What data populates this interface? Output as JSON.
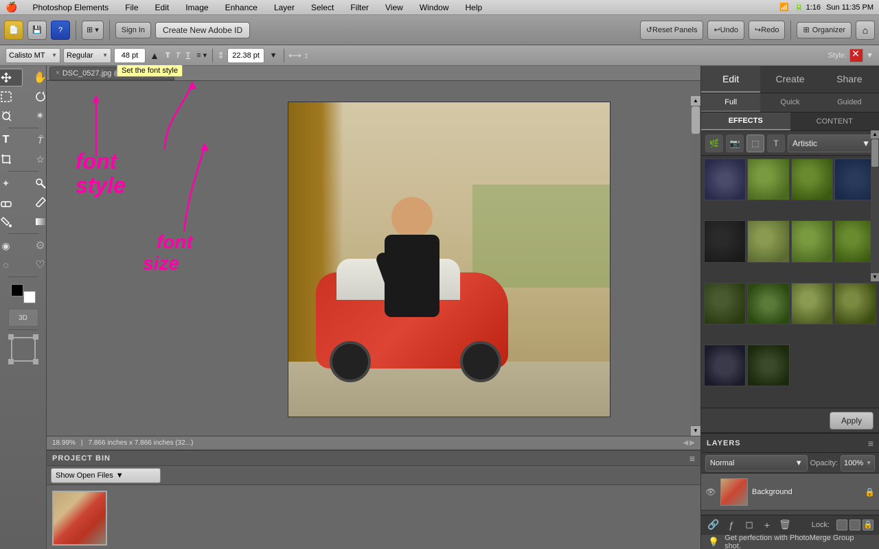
{
  "menubar": {
    "apple": "🍎",
    "app_name": "Photoshop Elements",
    "menus": [
      "File",
      "Edit",
      "Image",
      "Enhance",
      "Layer",
      "Select",
      "Filter",
      "View",
      "Window",
      "Help"
    ],
    "time": "Sun 11:35 PM",
    "battery": "1:16"
  },
  "toolbar": {
    "sign_in_label": "Sign In",
    "create_adobe_label": "Create New Adobe ID",
    "reset_panels_label": "Reset Panels",
    "undo_label": "Undo",
    "redo_label": "Redo",
    "organizer_label": "Organizer"
  },
  "font_toolbar": {
    "font_name": "Calisto MT",
    "font_style": "Regular",
    "font_size": "48 pt",
    "tooltip": "Set the font style",
    "style_label": "Style:"
  },
  "tab": {
    "name": "DSC_0527.jpg @ 19% (RGB/8)",
    "close": "×"
  },
  "annotations": {
    "font_style_label": "font\nstyle",
    "font_size_label": "font\nsize"
  },
  "status_bar": {
    "zoom": "18.99%",
    "dimensions": "7.866 inches x 7.866 inches (32...)"
  },
  "project_bin": {
    "title": "PROJECT BIN",
    "show_open_files": "Show Open Files"
  },
  "right_panel": {
    "tabs": [
      "Edit",
      "Create",
      "Share"
    ],
    "active_tab": "Edit",
    "subtabs": [
      "Full",
      "Quick",
      "Guided"
    ],
    "active_subtab": "Full"
  },
  "effects": {
    "tab_effects": "EFFECTS",
    "tab_content": "CONTENT",
    "active_tab": "EFFECTS",
    "dropdown_value": "Artistic",
    "apply_label": "Apply",
    "thumbnails": [
      {
        "id": 1,
        "class": "et1"
      },
      {
        "id": 2,
        "class": "et2"
      },
      {
        "id": 3,
        "class": "et3"
      },
      {
        "id": 4,
        "class": "et4"
      },
      {
        "id": 5,
        "class": "et5"
      },
      {
        "id": 6,
        "class": "et6"
      },
      {
        "id": 7,
        "class": "et7"
      },
      {
        "id": 8,
        "class": "et8"
      },
      {
        "id": 9,
        "class": "et9"
      },
      {
        "id": 10,
        "class": "et10"
      },
      {
        "id": 11,
        "class": "et11"
      },
      {
        "id": 12,
        "class": "et12"
      },
      {
        "id": 13,
        "class": "et13"
      },
      {
        "id": 14,
        "class": "et14"
      }
    ]
  },
  "layers": {
    "title": "LAYERS",
    "mode_label": "Normal",
    "opacity_label": "Opacity:",
    "opacity_value": "100%",
    "lock_label": "Lock:",
    "background_layer": "Background"
  },
  "bottom_status": {
    "text": "Get perfection with PhotoMerge Group shot."
  },
  "tools": {
    "items": [
      {
        "name": "move",
        "icon": "↖",
        "label": "Move Tool"
      },
      {
        "name": "zoom",
        "icon": "✋",
        "label": "Hand Tool"
      },
      {
        "name": "marquee",
        "icon": "⬚",
        "label": "Marquee Tool"
      },
      {
        "name": "lasso",
        "icon": "✦",
        "label": "Lasso Tool"
      },
      {
        "name": "magic",
        "icon": "✴",
        "label": "Magic Wand"
      },
      {
        "name": "type",
        "icon": "T",
        "label": "Type Tool"
      },
      {
        "name": "crop",
        "icon": "⊹",
        "label": "Crop Tool"
      },
      {
        "name": "heal",
        "icon": "✶",
        "label": "Healing Brush"
      },
      {
        "name": "clone",
        "icon": "⊗",
        "label": "Clone Stamp"
      },
      {
        "name": "eraser",
        "icon": "◻",
        "label": "Eraser"
      },
      {
        "name": "brush",
        "icon": "⊘",
        "label": "Brush Tool"
      },
      {
        "name": "settings",
        "icon": "⚙",
        "label": "Settings"
      },
      {
        "name": "blur",
        "icon": "◉",
        "label": "Blur"
      },
      {
        "name": "dodge",
        "icon": "▲",
        "label": "Dodge"
      },
      {
        "name": "shape",
        "icon": "☆",
        "label": "Shape Tool"
      },
      {
        "name": "eyedrop",
        "icon": "💧",
        "label": "Eyedropper"
      },
      {
        "name": "3d",
        "icon": "◈",
        "label": "3D Tool"
      },
      {
        "name": "transform",
        "icon": "⊡",
        "label": "Transform"
      }
    ]
  }
}
